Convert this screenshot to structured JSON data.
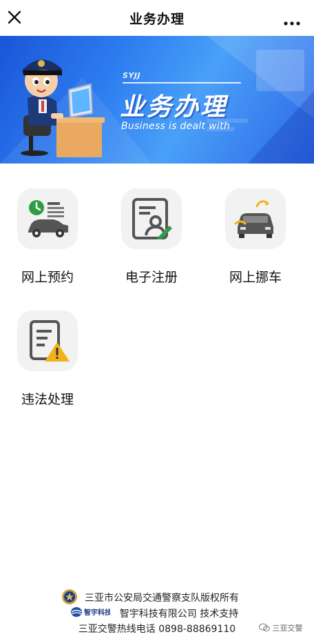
{
  "topbar": {
    "title": "业务办理",
    "close_icon": "close-icon",
    "more_icon": "more-dots-icon"
  },
  "banner": {
    "subtitle": "SYJJ",
    "title": "业务办理",
    "english": "Business is dealt with",
    "colors": {
      "start": "#1a55d8",
      "end": "#4aa0f8"
    }
  },
  "services": [
    {
      "label": "网上预约",
      "icon": "online-appointment-icon"
    },
    {
      "label": "电子注册",
      "icon": "e-registration-icon"
    },
    {
      "label": "网上挪车",
      "icon": "move-car-icon"
    },
    {
      "label": "违法处理",
      "icon": "violation-handling-icon"
    }
  ],
  "footer": {
    "copyright": "三亚市公安局交通警察支队版权所有",
    "support": "智宇科技有限公司 技术支持",
    "logo_text": "智宇科技",
    "hotline": "三亚交警热线电话 0898-88869110"
  },
  "watermark": {
    "text": "三亚交警"
  },
  "colors": {
    "accent_yellow": "#f2b21c",
    "icon_gray": "#555555",
    "icon_green": "#2e9e44",
    "tile_bg": "#f2f2f2"
  }
}
